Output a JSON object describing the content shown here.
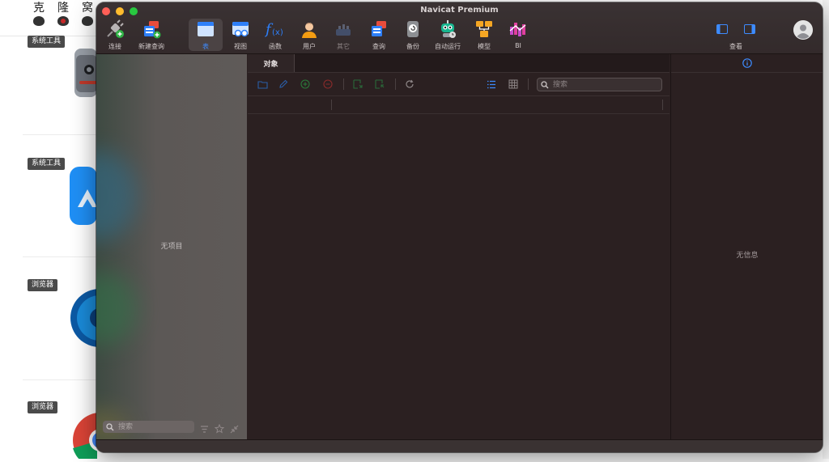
{
  "background_site": {
    "logo_chars": [
      "克",
      "隆",
      "窝"
    ],
    "categories": [
      {
        "label": "系统工具",
        "icon": "macos-utility-app-icon"
      },
      {
        "label": "系统工具",
        "icon": "blue-triangle-app-icon"
      },
      {
        "label": "浏览器",
        "icon": "edge-browser-icon"
      },
      {
        "label": "浏览器",
        "icon": "chrome-browser-icon"
      }
    ]
  },
  "window": {
    "title": "Navicat Premium"
  },
  "toolbar": {
    "items": [
      {
        "label": "连接",
        "icon": "connection-plug-icon"
      },
      {
        "label": "新建查询",
        "icon": "new-query-icon"
      },
      {
        "label": "表",
        "icon": "table-icon",
        "active": true
      },
      {
        "label": "视图",
        "icon": "view-icon"
      },
      {
        "label": "函数",
        "icon": "function-icon"
      },
      {
        "label": "用户",
        "icon": "user-icon"
      },
      {
        "label": "其它",
        "icon": "other-icon",
        "disabled": true
      },
      {
        "label": "查询",
        "icon": "query-icon"
      },
      {
        "label": "备份",
        "icon": "backup-icon"
      },
      {
        "label": "自动运行",
        "icon": "automation-robot-icon"
      },
      {
        "label": "模型",
        "icon": "model-icon"
      },
      {
        "label": "BI",
        "icon": "bi-icon"
      }
    ],
    "view_label": "查看"
  },
  "sidebar": {
    "empty_text": "无项目",
    "search_placeholder": "搜索"
  },
  "center": {
    "tab_label": "对象",
    "search_placeholder": "搜索"
  },
  "info_panel": {
    "empty_text": "无信息"
  },
  "colors": {
    "accent": "#3d8bff",
    "window_bg": "#2b2021",
    "close": "#ff5f57",
    "minimize": "#febc2e",
    "maximize": "#28c840"
  }
}
